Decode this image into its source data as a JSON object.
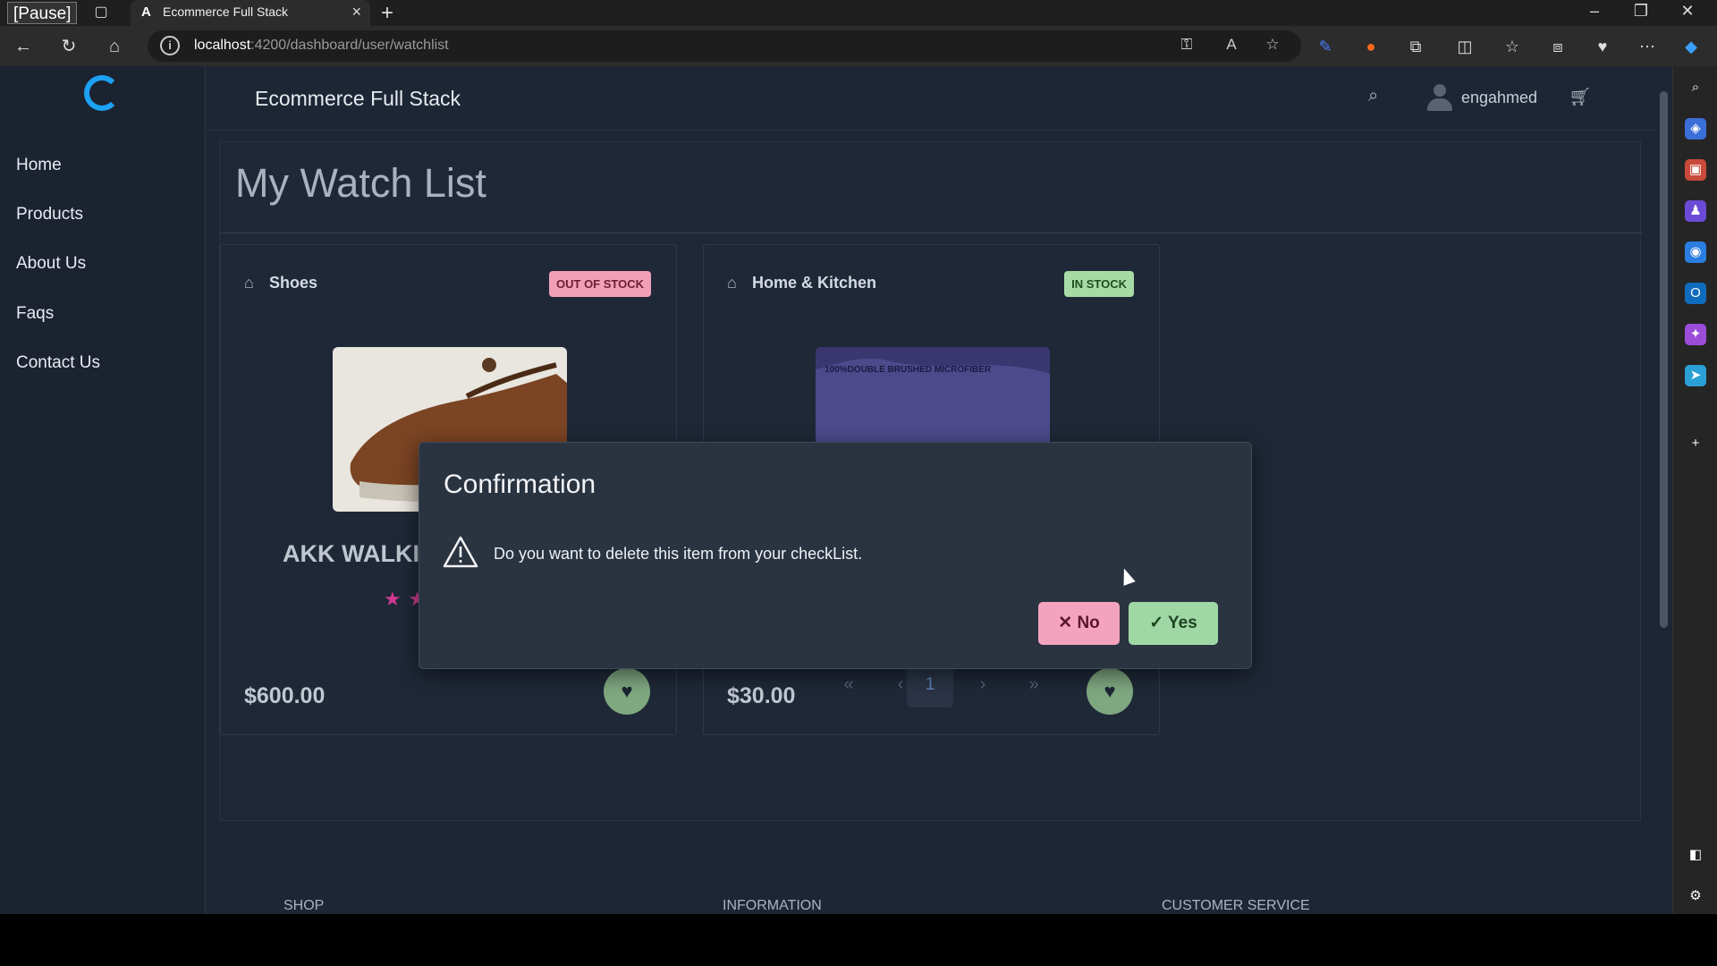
{
  "browser": {
    "pause_label": "[Pause]",
    "tab_title": "Ecommerce Full Stack",
    "url_host": "localhost",
    "url_path": ":4200/dashboard/user/watchlist"
  },
  "app": {
    "title": "Ecommerce Full Stack",
    "username": "engahmed"
  },
  "sidebar": {
    "items": [
      {
        "label": "Home"
      },
      {
        "label": "Products"
      },
      {
        "label": "About Us"
      },
      {
        "label": "Faqs"
      },
      {
        "label": "Contact Us"
      }
    ]
  },
  "main": {
    "page_title": "My Watch List",
    "cards": [
      {
        "category": "Shoes",
        "badge": "OUT OF STOCK",
        "name": "AKK WALKI",
        "price": "$600.00",
        "rating": 2,
        "rating_max": 5
      },
      {
        "category": "Home & Kitchen",
        "badge": "IN STOCK",
        "image_caption": "100%DOUBLE BRUSHED MICROFIBER",
        "price": "$30.00",
        "rating": 0,
        "rating_max": 5
      }
    ],
    "pager": {
      "first": "«",
      "prev": "‹",
      "current": "1",
      "next": "›",
      "last": "»"
    }
  },
  "footer": {
    "columns": [
      "SHOP",
      "INFORMATION",
      "CUSTOMER SERVICE"
    ]
  },
  "dialog": {
    "title": "Confirmation",
    "message": "Do you want to delete this item from your checkList.",
    "no_label": "No",
    "yes_label": "Yes"
  },
  "colors": {
    "badge_out": "#f19fb8",
    "badge_in": "#a6dba6",
    "button_no": "#f3a3bd",
    "button_yes": "#9fd8a5",
    "star": "#d03a8f"
  }
}
